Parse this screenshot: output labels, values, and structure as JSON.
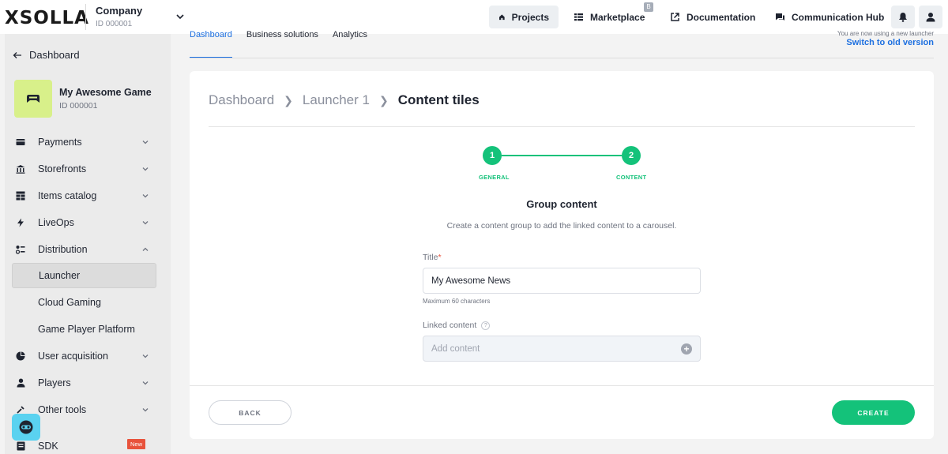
{
  "header": {
    "logo": "XSOLLA",
    "company_name": "Company",
    "company_id": "ID 000001",
    "nav": {
      "projects": "Projects",
      "marketplace": "Marketplace",
      "marketplace_badge": "B",
      "documentation": "Documentation",
      "communication_hub": "Communication Hub"
    }
  },
  "sidebar": {
    "back_label": "Dashboard",
    "project_name": "My Awesome Game",
    "project_id": "ID 000001",
    "items": [
      {
        "label": "Payments",
        "icon": "wallet-icon",
        "expandable": true
      },
      {
        "label": "Storefronts",
        "icon": "storefront-icon",
        "expandable": true
      },
      {
        "label": "Items catalog",
        "icon": "catalog-icon",
        "expandable": true
      },
      {
        "label": "LiveOps",
        "icon": "bolt-icon",
        "expandable": true
      },
      {
        "label": "Distribution",
        "icon": "distribution-icon",
        "expandable": true,
        "expanded": true
      },
      {
        "label": "Launcher",
        "active": true
      },
      {
        "label": "Cloud Gaming"
      },
      {
        "label": "Game Player Platform"
      },
      {
        "label": "User acquisition",
        "icon": "acquisition-icon",
        "expandable": true
      },
      {
        "label": "Players",
        "icon": "player-icon",
        "expandable": true
      },
      {
        "label": "Other tools",
        "icon": "tools-icon",
        "expandable": true
      },
      {
        "label": "SDK",
        "icon": "sdk-icon"
      }
    ],
    "sdk_badge": "New"
  },
  "tabs": [
    "Dashboard",
    "Business solutions",
    "Analytics"
  ],
  "notice": {
    "text": "You are now using a new launcher",
    "switch_link": "Switch to old version"
  },
  "breadcrumb": {
    "items": [
      "Dashboard",
      "Launcher 1"
    ],
    "current": "Content tiles"
  },
  "stepper": {
    "steps": [
      {
        "number": "1",
        "label": "GENERAL"
      },
      {
        "number": "2",
        "label": "CONTENT"
      }
    ]
  },
  "form": {
    "section_title": "Group content",
    "section_desc": "Create a content group to add the linked content to a carousel.",
    "title_label": "Title",
    "title_required": "*",
    "title_value": "My Awesome News",
    "title_hint": "Maximum 60 characters",
    "linked_label": "Linked content",
    "linked_placeholder": "Add content"
  },
  "actions": {
    "back": "BACK",
    "create": "CREATE"
  },
  "colors": {
    "accent_green": "#14c27a",
    "link_blue": "#1c6fe0",
    "project_avatar": "#d8f08a",
    "new_badge": "#e8533c"
  }
}
